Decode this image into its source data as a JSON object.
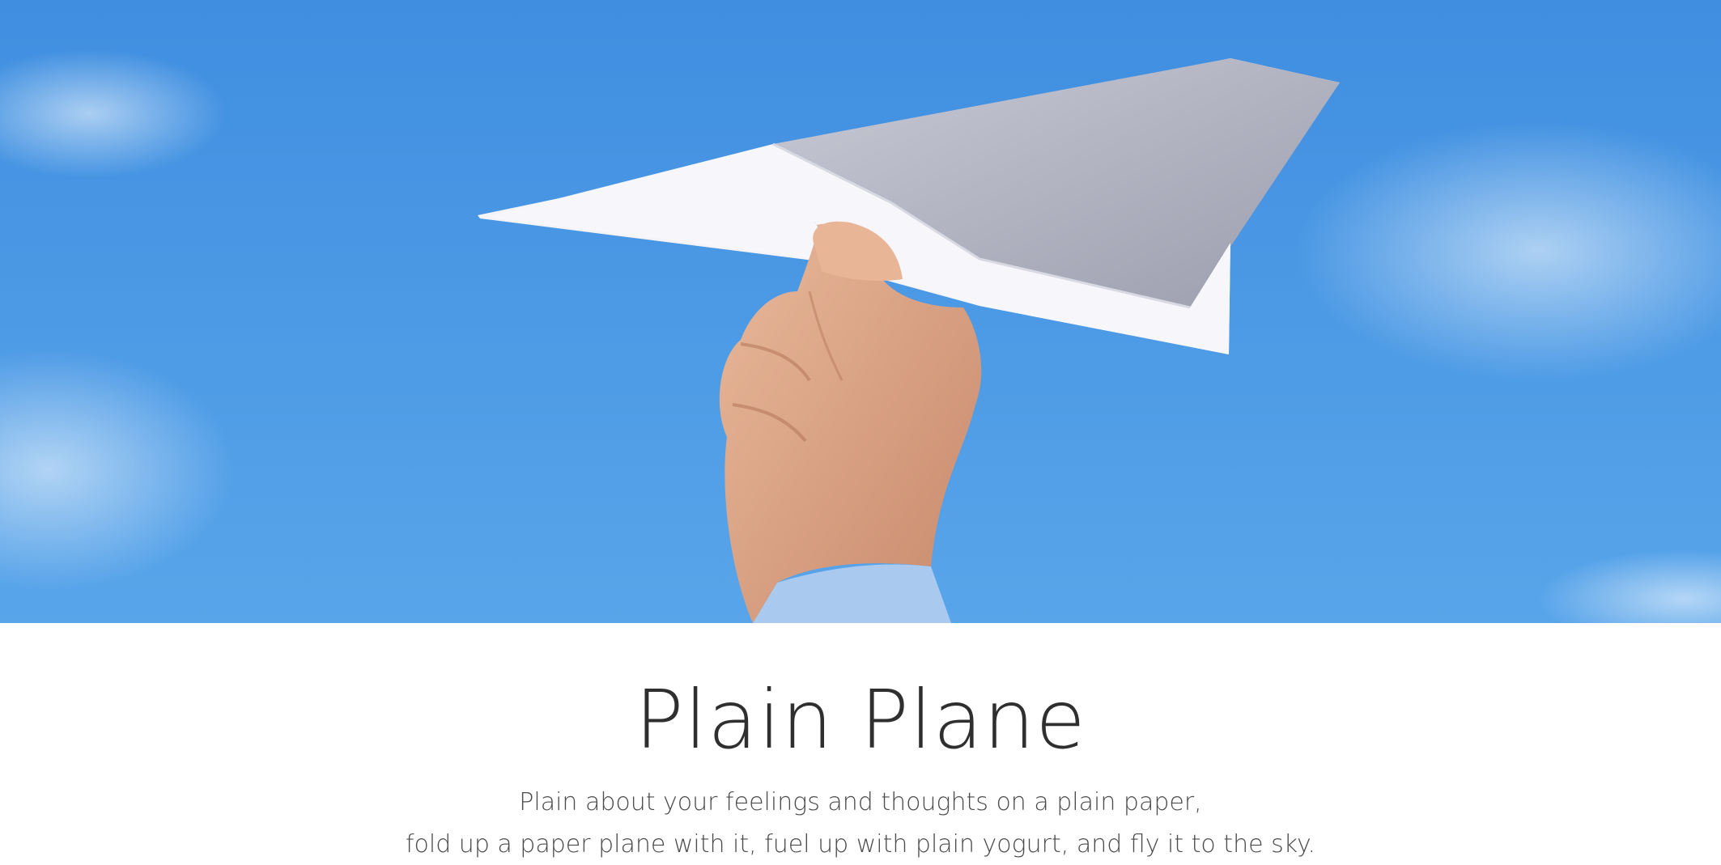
{
  "hero": {
    "image_subject": "hand-holding-paper-plane"
  },
  "content": {
    "title": "Plain Plane",
    "subtitle_line1": "Plain about your feelings and thoughts on a plain paper,",
    "subtitle_line2": "fold up a paper plane with it, fuel up with plain yogurt, and fly it to the sky."
  },
  "colors": {
    "sky_top": "#3f8fe0",
    "sky_bottom": "#5aa6ea",
    "title_text": "#2f2f2f",
    "subtitle_text": "#4b4b4b"
  }
}
